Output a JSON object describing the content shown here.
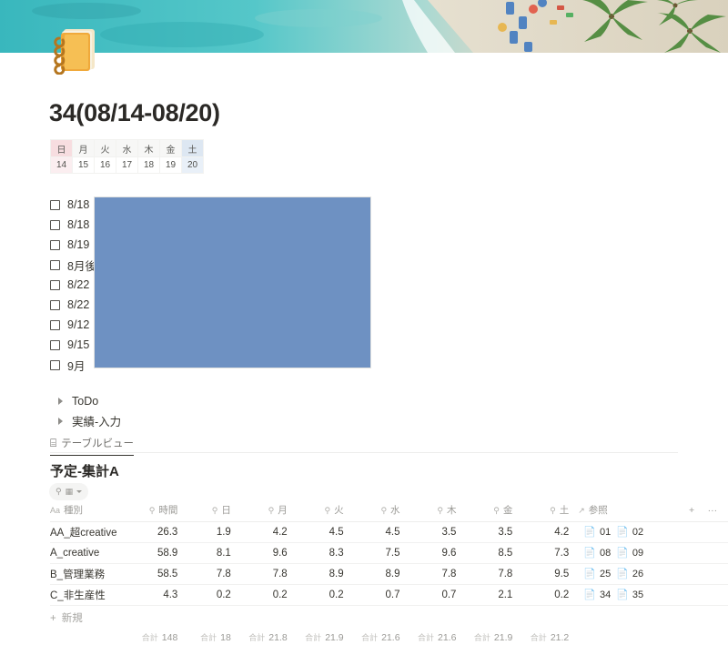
{
  "cover": {
    "alt": "beach-aerial-cover"
  },
  "icon": {
    "name": "notebook-emoji",
    "glyph": "📒"
  },
  "title": "34(08/14-08/20)",
  "calendar": {
    "dow": [
      "日",
      "月",
      "火",
      "水",
      "木",
      "金",
      "土"
    ],
    "days": [
      "14",
      "15",
      "16",
      "17",
      "18",
      "19",
      "20"
    ]
  },
  "todos": [
    {
      "label": "8/18"
    },
    {
      "label": "8/18"
    },
    {
      "label": "8/19"
    },
    {
      "label": "8月後"
    },
    {
      "label": "8/22"
    },
    {
      "label": "8/22"
    },
    {
      "label": "9/12"
    },
    {
      "label": "9/15"
    },
    {
      "label": "9月"
    }
  ],
  "toggles": [
    {
      "label": "ToDo"
    },
    {
      "label": "実績-入力"
    }
  ],
  "view_tab": {
    "label": "テーブルビュー",
    "icon": "⌸"
  },
  "database": {
    "title": "予定-集計A",
    "filter_chip": {
      "search_icon": "⚲",
      "value_icon": "▦"
    },
    "columns": [
      {
        "label": "種別",
        "icon": "Aa"
      },
      {
        "label": "時間",
        "icon": "⚲"
      },
      {
        "label": "日",
        "icon": "⚲"
      },
      {
        "label": "月",
        "icon": "⚲"
      },
      {
        "label": "火",
        "icon": "⚲"
      },
      {
        "label": "水",
        "icon": "⚲"
      },
      {
        "label": "木",
        "icon": "⚲"
      },
      {
        "label": "金",
        "icon": "⚲"
      },
      {
        "label": "土",
        "icon": "⚲"
      },
      {
        "label": "参照",
        "icon": "↗"
      }
    ],
    "add_column_label": "+",
    "more_label": "···",
    "rows": [
      {
        "kind": "AA_超creative",
        "time": "26.3",
        "sun": "1.9",
        "mon": "4.2",
        "tue": "4.5",
        "wed": "4.5",
        "thu": "3.5",
        "fri": "3.5",
        "sat": "4.2",
        "refs": [
          "01",
          "02"
        ]
      },
      {
        "kind": "A_creative",
        "time": "58.9",
        "sun": "8.1",
        "mon": "9.6",
        "tue": "8.3",
        "wed": "7.5",
        "thu": "9.6",
        "fri": "8.5",
        "sat": "7.3",
        "refs": [
          "08",
          "09"
        ]
      },
      {
        "kind": "B_管理業務",
        "time": "58.5",
        "sun": "7.8",
        "mon": "7.8",
        "tue": "8.9",
        "wed": "8.9",
        "thu": "7.8",
        "fri": "7.8",
        "sat": "9.5",
        "refs": [
          "25",
          "26"
        ]
      },
      {
        "kind": "C_非生産性",
        "time": "4.3",
        "sun": "0.2",
        "mon": "0.2",
        "tue": "0.2",
        "wed": "0.7",
        "thu": "0.7",
        "fri": "2.1",
        "sat": "0.2",
        "refs": [
          "34",
          "35"
        ]
      }
    ],
    "new_row_label": "新規",
    "totals_label": "合計",
    "totals": [
      "148",
      "18",
      "21.8",
      "21.9",
      "21.6",
      "21.6",
      "21.9",
      "21.2"
    ]
  },
  "colors": {
    "overlay_blue": "#6e91c2",
    "sunday_bg": "#f7dde0",
    "saturday_bg": "#dde7f2"
  }
}
